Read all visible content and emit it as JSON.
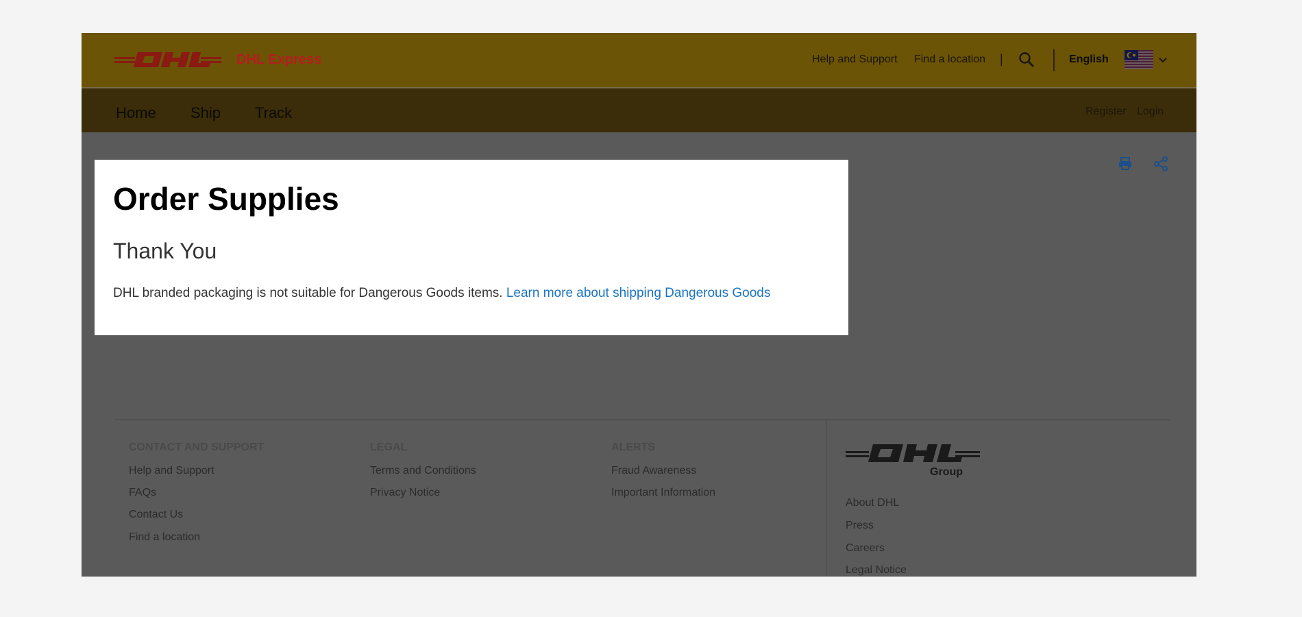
{
  "header": {
    "brand_text": "DHL Express",
    "utility_links": [
      "Help and Support",
      "Find a location"
    ],
    "separator": "|",
    "language": "English",
    "country_flag": "malaysia-flag-icon"
  },
  "nav": {
    "items": [
      "Home",
      "Ship",
      "Track"
    ],
    "register": "Register",
    "login": "Login"
  },
  "content": {
    "title": "Order Supplies",
    "subtitle": "Thank You",
    "notice_text": "DHL branded packaging is not suitable for Dangerous Goods items.",
    "notice_link": "Learn more about shipping Dangerous Goods"
  },
  "footer": {
    "columns": [
      {
        "heading": "CONTACT AND SUPPORT",
        "links": [
          "Help and Support",
          "FAQs",
          "Contact Us",
          "Find a location"
        ]
      },
      {
        "heading": "LEGAL",
        "links": [
          "Terms and Conditions",
          "Privacy Notice"
        ]
      },
      {
        "heading": "ALERTS",
        "links": [
          "Fraud Awareness",
          "Important Information"
        ]
      }
    ],
    "group_label": "Group",
    "group_links": [
      "About DHL",
      "Press",
      "Careers",
      "Legal Notice"
    ]
  },
  "colors": {
    "brand_red": "#b51e1e",
    "brand_yellow": "#ffcc00",
    "link_blue": "#1a73c2"
  }
}
